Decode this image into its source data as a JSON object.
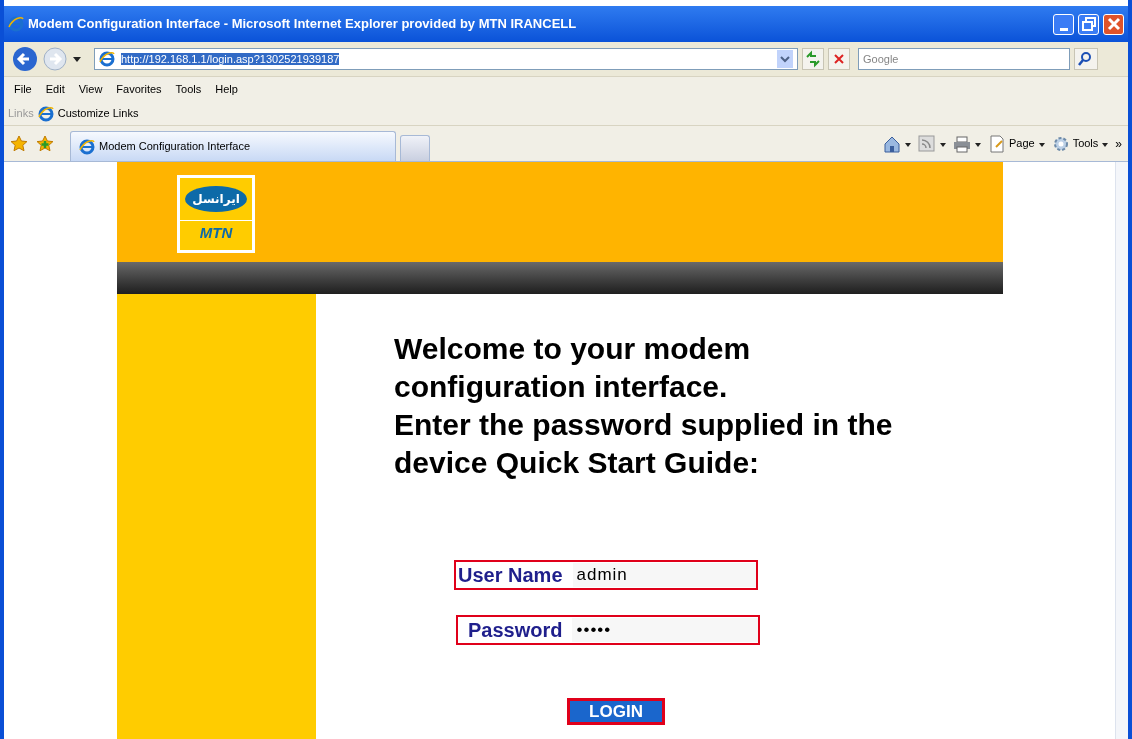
{
  "window": {
    "title": "Modem Configuration Interface - Microsoft Internet Explorer provided by MTN IRANCELL"
  },
  "address_bar": {
    "value": "http://192.168.1.1/login.asp?1302521939187",
    "selected": true
  },
  "search": {
    "placeholder": "Google"
  },
  "menu": [
    "File",
    "Edit",
    "View",
    "Favorites",
    "Tools",
    "Help"
  ],
  "links_bar": {
    "label": "Links",
    "items": [
      "Customize Links"
    ]
  },
  "tabs": [
    {
      "label": "Modem Configuration Interface",
      "selected": true
    }
  ],
  "command_bar": {
    "items": [
      {
        "kind": "home"
      },
      {
        "kind": "feeds"
      },
      {
        "kind": "print"
      },
      {
        "kind": "page",
        "label": "Page"
      },
      {
        "kind": "tools",
        "label": "Tools"
      }
    ],
    "overflow": "»"
  },
  "page": {
    "logo": {
      "persian": "ایرانسل",
      "latin": "MTN"
    },
    "welcome": [
      "Welcome to your modem",
      "configuration interface.",
      "Enter the password supplied in the",
      "device Quick Start Guide:"
    ],
    "username_field": {
      "label": "User Name",
      "value": "admin"
    },
    "password_field": {
      "label": "Password",
      "value": "•••••"
    },
    "login_button": "LOGIN"
  }
}
